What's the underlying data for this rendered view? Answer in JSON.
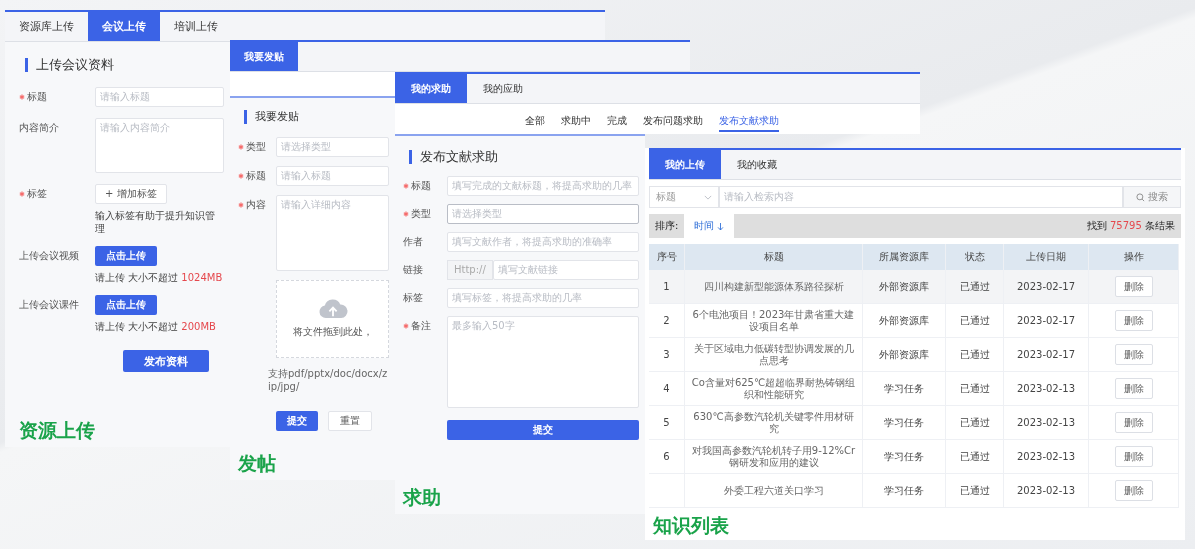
{
  "resource_upload": {
    "tabs": [
      {
        "label": "资源库上传",
        "selected": false
      },
      {
        "label": "会议上传",
        "selected": true
      },
      {
        "label": "培训上传",
        "selected": false
      }
    ],
    "heading": "上传会议资料",
    "fields": [
      {
        "kind": "input",
        "label": "标题",
        "required": true,
        "placeholder": "请输入标题"
      },
      {
        "kind": "textarea",
        "label": "内容简介",
        "required": false,
        "placeholder": "请输入内容简介"
      },
      {
        "kind": "tag",
        "label": "标签",
        "required": true,
        "button": "+ 增加标签",
        "hint": "输入标签有助于提升知识管理"
      },
      {
        "kind": "upload",
        "label": "上传会议视频",
        "required": false,
        "button": "点击上传",
        "hint": "请上传 大小不超过",
        "limit": "1024MB"
      },
      {
        "kind": "upload",
        "label": "上传会议课件",
        "required": false,
        "button": "点击上传",
        "hint": "请上传 大小不超过",
        "limit": "200MB"
      }
    ],
    "submit": "发布资料",
    "caption": "资源上传"
  },
  "post": {
    "tabs": [
      {
        "label": "我要发贴",
        "selected": true
      }
    ],
    "heading": "我要发贴",
    "fields": [
      {
        "kind": "select",
        "label": "类型",
        "required": true,
        "placeholder": "请选择类型"
      },
      {
        "kind": "input",
        "label": "标题",
        "required": true,
        "placeholder": "请输入标题"
      },
      {
        "kind": "textarea",
        "label": "内容",
        "required": true,
        "placeholder": "请输入详细内容"
      }
    ],
    "dropzone": {
      "text": "将文件拖到此处，",
      "support": "支持pdf/pptx/doc/docx/zip/jpg/"
    },
    "buttons": [
      {
        "label": "提交",
        "kind": "primary"
      },
      {
        "label": "重置",
        "kind": "default"
      }
    ],
    "caption": "发帖"
  },
  "help": {
    "tabs": [
      {
        "label": "我的求助",
        "selected": true
      },
      {
        "label": "我的应助",
        "selected": false
      }
    ],
    "filters": [
      {
        "label": "全部",
        "selected": false
      },
      {
        "label": "求助中",
        "selected": false
      },
      {
        "label": "完成",
        "selected": false
      },
      {
        "label": "发布问题求助",
        "selected": false
      },
      {
        "label": "发布文献求助",
        "selected": true
      }
    ],
    "heading": "发布文献求助",
    "fields": [
      {
        "kind": "input",
        "label": "标题",
        "required": true,
        "placeholder": "填写完成的文献标题，将提高求助的几率"
      },
      {
        "kind": "select",
        "label": "类型",
        "required": true,
        "placeholder": "请选择类型"
      },
      {
        "kind": "input",
        "label": "作者",
        "required": false,
        "placeholder": "填写文献作者，将提高求助的准确率"
      },
      {
        "kind": "link",
        "label": "链接",
        "required": false,
        "prefix": "Http://",
        "placeholder": "填写文献链接"
      },
      {
        "kind": "input",
        "label": "标签",
        "required": false,
        "placeholder": "填写标签，将提高求助的几率"
      },
      {
        "kind": "textarea",
        "label": "备注",
        "required": true,
        "placeholder": "最多输入50字"
      }
    ],
    "submit": "提交",
    "caption": "求助"
  },
  "knowledge_list": {
    "tabs": [
      {
        "label": "我的上传",
        "selected": true
      },
      {
        "label": "我的收藏",
        "selected": false
      }
    ],
    "search": {
      "field": "标题",
      "placeholder": "请输入检索内容",
      "button": "搜索"
    },
    "sort": {
      "label": "排序:",
      "options": [
        {
          "label": "时间",
          "selected": true
        }
      ],
      "found_prefix": "找到",
      "count": "75795",
      "found_suffix": "条结果"
    },
    "table": {
      "columns": [
        "序号",
        "标题",
        "所属资源库",
        "状态",
        "上传日期",
        "操作"
      ],
      "rows": [
        {
          "seq": "1",
          "title": "四川构建新型能源体系路径探析",
          "library": "外部资源库",
          "status": "已通过",
          "date": "2023-02-17",
          "action": "删除",
          "selected": true
        },
        {
          "seq": "2",
          "title": "6个电池项目！2023年甘肃省重大建设项目名单",
          "library": "外部资源库",
          "status": "已通过",
          "date": "2023-02-17",
          "action": "删除",
          "selected": false
        },
        {
          "seq": "3",
          "title": "关于区域电力低碳转型协调发展的几点思考",
          "library": "外部资源库",
          "status": "已通过",
          "date": "2023-02-17",
          "action": "删除",
          "selected": false
        },
        {
          "seq": "4",
          "title": "Co含量对625℃超超临界耐热铸钢组织和性能研究",
          "library": "学习任务",
          "status": "已通过",
          "date": "2023-02-13",
          "action": "删除",
          "selected": false
        },
        {
          "seq": "5",
          "title": "630℃高参数汽轮机关键零件用材研究",
          "library": "学习任务",
          "status": "已通过",
          "date": "2023-02-13",
          "action": "删除",
          "selected": false
        },
        {
          "seq": "6",
          "title": "对我国高参数汽轮机转子用9-12%Cr钢研发和应用的建议",
          "library": "学习任务",
          "status": "已通过",
          "date": "2023-02-13",
          "action": "删除",
          "selected": false
        },
        {
          "title": "外委工程六道关口学习",
          "library": "学习任务",
          "status": "已通过",
          "date": "2023-02-13",
          "action": "删除",
          "selected": false
        }
      ]
    },
    "caption": "知识列表"
  }
}
